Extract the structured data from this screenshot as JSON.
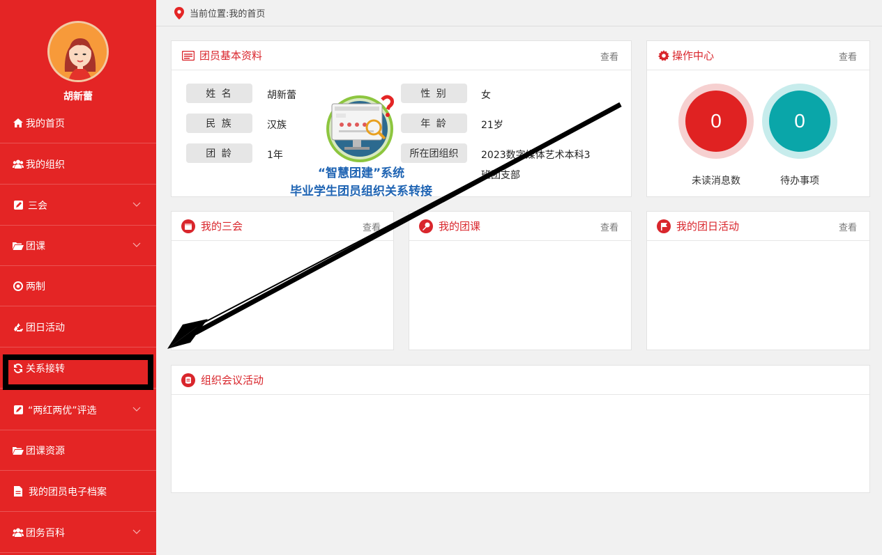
{
  "user": {
    "name": "胡新蕾"
  },
  "sidebar": {
    "items": [
      {
        "label": "我的首页",
        "icon": "home-icon",
        "has_chevron": false
      },
      {
        "label": "我的组织",
        "icon": "users-icon",
        "has_chevron": false
      },
      {
        "label": "三会",
        "icon": "edit-icon",
        "has_chevron": true
      },
      {
        "label": "团课",
        "icon": "folder-open-icon",
        "has_chevron": true
      },
      {
        "label": "两制",
        "icon": "target-icon",
        "has_chevron": false
      },
      {
        "label": "团日活动",
        "icon": "recycle-icon",
        "has_chevron": false
      },
      {
        "label": "关系接转",
        "icon": "refresh-icon",
        "has_chevron": false
      },
      {
        "label": "“两红两优”评选",
        "icon": "edit-icon",
        "has_chevron": true
      },
      {
        "label": "团课资源",
        "icon": "folder-open-icon",
        "has_chevron": false
      },
      {
        "label": "我的团员电子档案",
        "icon": "file-icon",
        "has_chevron": false
      },
      {
        "label": "团务百科",
        "icon": "users-icon",
        "has_chevron": true
      }
    ]
  },
  "breadcrumb": {
    "text": "当前位置:我的首页"
  },
  "profile_card": {
    "title": "团员基本资料",
    "view": "查看",
    "fields": [
      {
        "label": "姓 名",
        "value": "胡新蕾"
      },
      {
        "label": "性 别",
        "value": "女"
      },
      {
        "label": "民 族",
        "value": "汉族"
      },
      {
        "label": "年 龄",
        "value": "21岁"
      },
      {
        "label": "团 龄",
        "value": "1年"
      },
      {
        "label": "所在团组织",
        "value": "2023数字媒体艺术本科3",
        "value2": "班团支部"
      }
    ]
  },
  "overlay": {
    "line1": "“智慧团建”系统",
    "line2": "毕业学生团员组织关系转接"
  },
  "ops_card": {
    "title": "操作中心",
    "view": "查看",
    "unread": {
      "count": "0",
      "label": "未读消息数",
      "color": "#e02222"
    },
    "todo": {
      "count": "0",
      "label": "待办事项",
      "color": "#0aa6a9"
    }
  },
  "three_meetings": {
    "title": "我的三会",
    "view": "查看"
  },
  "my_lessons": {
    "title": "我的团课",
    "view": "查看"
  },
  "activities": {
    "title": "我的团日活动",
    "view": "查看"
  },
  "org_meetings": {
    "title": "组织会议活动"
  },
  "colors": {
    "sidebar": "#e42525",
    "accent": "#d9262c"
  }
}
